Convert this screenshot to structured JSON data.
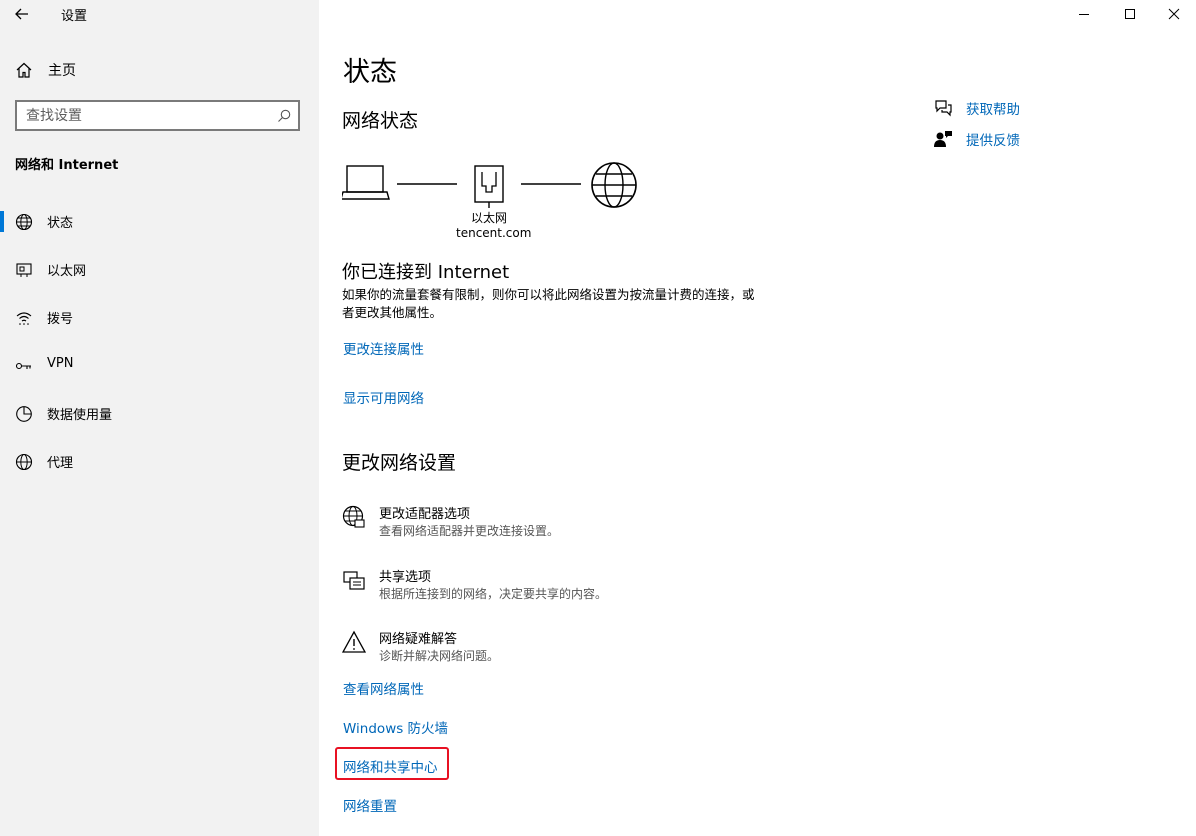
{
  "app": {
    "title": "设置"
  },
  "sidebar": {
    "home_label": "主页",
    "search_placeholder": "查找设置",
    "section_title": "网络和 Internet",
    "items": [
      {
        "label": "状态",
        "icon": "globe-status-icon",
        "selected": true
      },
      {
        "label": "以太网",
        "icon": "ethernet-icon",
        "selected": false
      },
      {
        "label": "拨号",
        "icon": "dialup-icon",
        "selected": false
      },
      {
        "label": "VPN",
        "icon": "vpn-icon",
        "selected": false
      },
      {
        "label": "数据使用量",
        "icon": "data-usage-icon",
        "selected": false
      },
      {
        "label": "代理",
        "icon": "proxy-globe-icon",
        "selected": false
      }
    ],
    "accent_color": "#0078d7"
  },
  "main": {
    "page_title": "状态",
    "network_status_heading": "网络状态",
    "diagram": {
      "adapter_name": "以太网",
      "network_name": "tencent.com"
    },
    "connected_title": "你已连接到 Internet",
    "connected_desc": "如果你的流量套餐有限制，则你可以将此网络设置为按流量计费的连接，或者更改其他属性。",
    "links_top": {
      "change_connection_properties": "更改连接属性",
      "show_available_networks": "显示可用网络"
    },
    "change_settings_heading": "更改网络设置",
    "options": [
      {
        "title": "更改适配器选项",
        "subtitle": "查看网络适配器并更改连接设置。",
        "icon": "adapter-globe-icon"
      },
      {
        "title": "共享选项",
        "subtitle": "根据所连接到的网络，决定要共享的内容。",
        "icon": "sharing-icon"
      },
      {
        "title": "网络疑难解答",
        "subtitle": "诊断并解决网络问题。",
        "icon": "warning-icon"
      }
    ],
    "links_bottom": {
      "view_properties": "查看网络属性",
      "firewall": "Windows 防火墙",
      "sharing_center": "网络和共享中心",
      "reset": "网络重置"
    },
    "help": {
      "get_help": "获取帮助",
      "feedback": "提供反馈"
    },
    "link_color": "#0067b8",
    "highlight_color": "#e81123"
  }
}
